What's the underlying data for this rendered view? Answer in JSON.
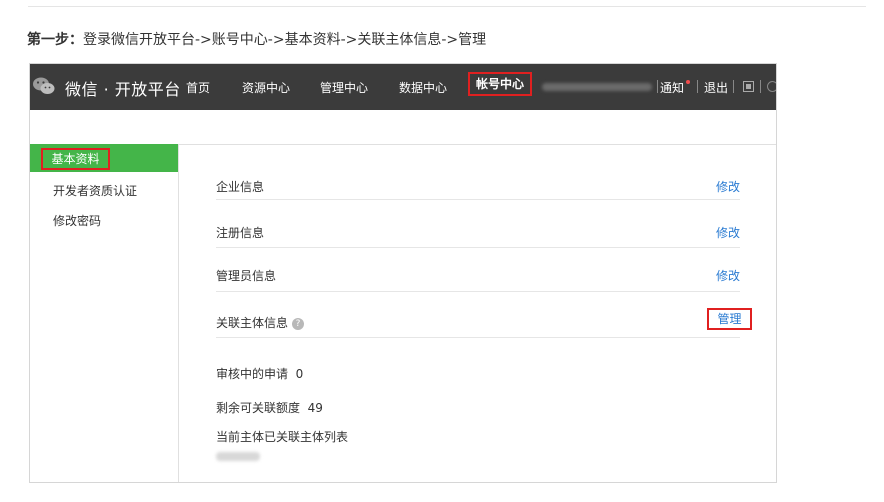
{
  "instruction": {
    "prefix": "第一步：",
    "text": "登录微信开放平台->账号中心->基本资料->关联主体信息->管理"
  },
  "topbar": {
    "brand": "微信 · 开放平台",
    "nav": [
      "首页",
      "资源中心",
      "管理中心",
      "数据中心"
    ],
    "active_nav": "帐号中心",
    "notice": "通知",
    "logout": "退出",
    "colors": {
      "background": "#3b3b3b",
      "highlight": "#e02020"
    }
  },
  "sidebar": {
    "active": "基本资料",
    "items": [
      "开发者资质认证",
      "修改密码"
    ],
    "accent": "#44b549"
  },
  "main": {
    "rows": [
      {
        "label": "企业信息",
        "action": "修改"
      },
      {
        "label": "注册信息",
        "action": "修改"
      },
      {
        "label": "管理员信息",
        "action": "修改"
      }
    ],
    "linked": {
      "label": "关联主体信息",
      "help": "?",
      "action": "管理"
    },
    "pending_label": "审核中的申请",
    "pending_value": "0",
    "quota_label": "剩余可关联额度",
    "quota_value": "49",
    "list_label": "当前主体已关联主体列表",
    "link_color": "#2a7bd2"
  }
}
